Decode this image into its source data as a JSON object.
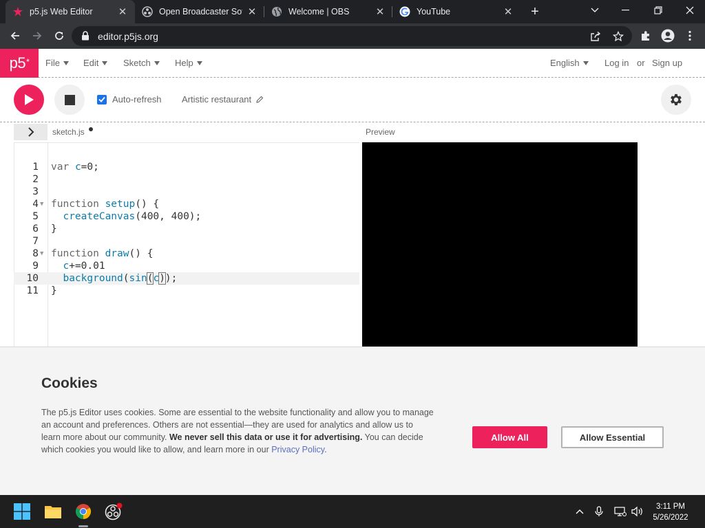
{
  "browser": {
    "tabs": [
      {
        "title": "p5.js Web Editor",
        "active": true
      },
      {
        "title": "Open Broadcaster Software",
        "active": false
      },
      {
        "title": "Welcome | OBS",
        "active": false
      },
      {
        "title": "YouTube",
        "active": false
      }
    ],
    "url": "editor.p5js.org"
  },
  "p5": {
    "logo": "p5",
    "logo_sup": "*",
    "menu": [
      {
        "label": "File"
      },
      {
        "label": "Edit"
      },
      {
        "label": "Sketch"
      },
      {
        "label": "Help"
      }
    ],
    "language": "English",
    "login": "Log in",
    "or": "or",
    "signup": "Sign up",
    "auto_refresh": "Auto-refresh",
    "auto_refresh_checked": true,
    "sketch_name": "Artistic restaurant",
    "file_name": "sketch.js",
    "preview_label": "Preview"
  },
  "editor": {
    "line_numbers": [
      "1",
      "2",
      "3",
      "4",
      "5",
      "6",
      "7",
      "8",
      "9",
      "10",
      "11"
    ],
    "highlighted_line": 10
  },
  "cookies": {
    "title": "Cookies",
    "text_1": "The p5.js Editor uses cookies. Some are essential to the website functionality and allow you to manage an account and preferences. Others are not essential—they are used for analytics and allow us to learn more about our community. ",
    "text_bold": "We never sell this data or use it for advertising.",
    "text_2": " You can decide which cookies you would like to allow, and learn more in our ",
    "link": "Privacy Policy",
    "text_end": ".",
    "allow_all": "Allow All",
    "allow_essential": "Allow Essential"
  },
  "taskbar": {
    "time": "3:11 PM",
    "date": "5/26/2022"
  },
  "colors": {
    "p5_pink": "#ed225d",
    "chrome_dark": "#202124",
    "chrome_toolbar": "#35363a",
    "code_blue": "#0b7ca9"
  }
}
